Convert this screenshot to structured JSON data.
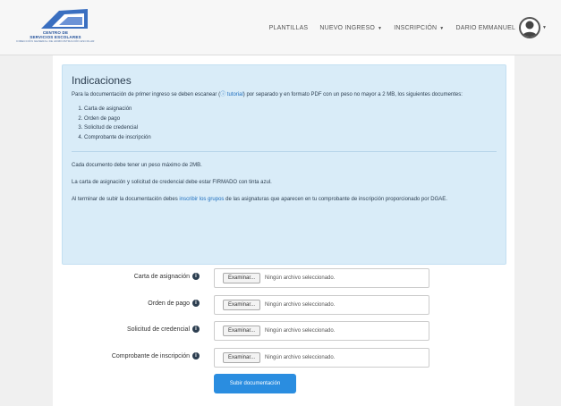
{
  "navbar": {
    "logo": {
      "line1": "CENTRO DE",
      "line2": "SERVICIOS ESCOLARES",
      "line3": "DIRECCIÓN GENERAL DE ADMINISTRACIÓN ESCOLAR"
    },
    "items": [
      {
        "label": "PLANTILLAS",
        "dropdown": false
      },
      {
        "label": "NUEVO INGRESO",
        "dropdown": true
      },
      {
        "label": "INSCRIPCIÓN",
        "dropdown": true
      }
    ],
    "user": {
      "label": "DARIO EMMANUEL"
    }
  },
  "indications": {
    "title": "Indicaciones",
    "intro_before": "Para la documentación de primer ingreso se deben escanear (",
    "tutorial_link": "tutorial",
    "intro_after": ") por separado y en formato PDF con un peso no mayor a 2 MB, los siguientes documentes:",
    "documents": [
      "Carta de asignación",
      "Orden de pago",
      "Solicitud de credencial",
      "Comprobante de inscripción"
    ],
    "note_size": "Cada documento debe tener un peso máximo de 2MB.",
    "note_signed": "La carta de asignación y solicitud de credencial debe estar FIRMADO con tinta azul.",
    "note_final_before": "Al terminar de subir la documentación debes ",
    "note_final_link": "inscribir los grupos",
    "note_final_after": " de las asignaturas que aparecen en tu comprobante de inscripción proporcionado por DGAE."
  },
  "form": {
    "rows": [
      {
        "label": "Carta de asignación",
        "button": "Examinar...",
        "status": "Ningún archivo seleccionado."
      },
      {
        "label": "Orden de pago",
        "button": "Examinar...",
        "status": "Ningún archivo seleccionado."
      },
      {
        "label": "Solicitud de credencial",
        "button": "Examinar...",
        "status": "Ningún archivo seleccionado."
      },
      {
        "label": "Comprobante de inscripción",
        "button": "Examinar...",
        "status": "Ningún archivo seleccionado."
      }
    ],
    "submit_label": "Subir documentación"
  },
  "colors": {
    "alert_bg": "#d9ecf8",
    "link": "#1f6fbf",
    "primary_button": "#2a8de0"
  }
}
